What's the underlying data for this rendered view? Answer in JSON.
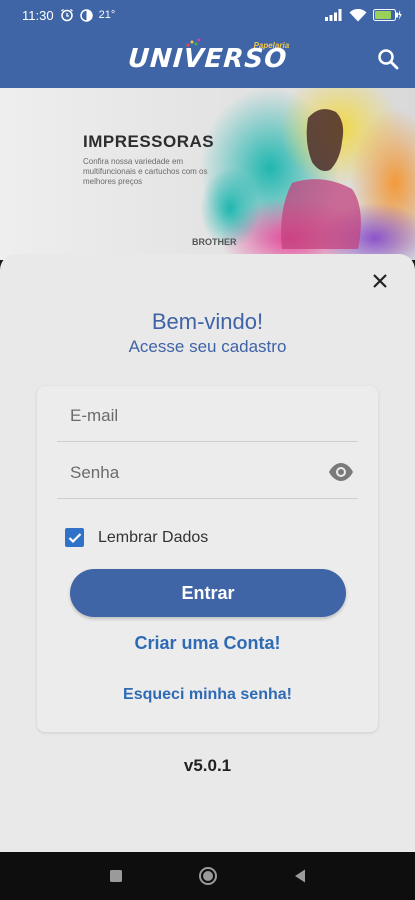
{
  "status_bar": {
    "time": "11:30",
    "temperature": "21"
  },
  "app_bar": {
    "logo_small": "Papelaria",
    "logo_main": "UNIVERSO"
  },
  "banner": {
    "title": "IMPRESSORAS",
    "subtitle": "Confira nossa variedade em multifuncionais e cartuchos com os melhores preços",
    "brand": "BROTHER"
  },
  "login": {
    "welcome": "Bem-vindo!",
    "subtitle": "Acesse seu cadastro",
    "email_placeholder": "E-mail",
    "password_placeholder": "Senha",
    "remember_label": "Lembrar Dados",
    "remember_checked": true,
    "login_button": "Entrar",
    "create_account": "Criar uma Conta!",
    "forgot_password": "Esqueci minha senha!"
  },
  "version": "v5.0.1",
  "colors": {
    "primary": "#4065a6",
    "link": "#2f6bb5",
    "checkbox": "#2f72c8",
    "sheet_bg": "#e9e9e9"
  },
  "icons": {
    "status": [
      "alarm-icon",
      "data-saver-icon",
      "signal-icon",
      "wifi-icon",
      "battery-icon"
    ],
    "search": "search-icon",
    "close": "close-icon",
    "eye": "eye-icon",
    "nav": [
      "recents-icon",
      "home-icon",
      "back-icon"
    ]
  }
}
